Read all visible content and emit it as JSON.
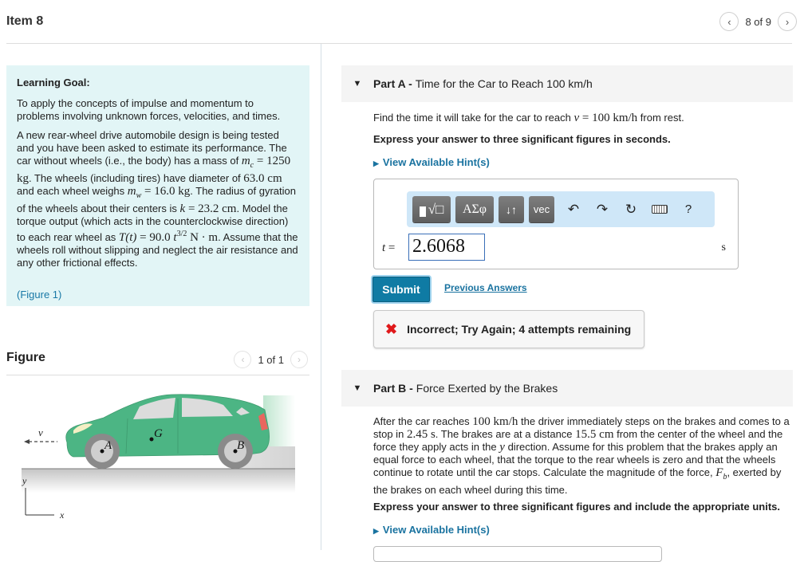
{
  "header": {
    "title": "Item 8",
    "pager_text": "8 of 9",
    "prev_icon": "chevron-left-icon",
    "next_icon": "chevron-right-icon"
  },
  "learning_goal": {
    "heading": "Learning Goal:",
    "intro": "To apply the concepts of impulse and momentum to problems involving unknown forces, velocities, and times.",
    "p1_a": "A new rear-wheel drive automobile design is being tested and you have been asked to estimate its performance. The car without wheels (i.e., the body) has a mass of",
    "mc_sym": "m",
    "mc_sub": "c",
    "mc_val": " = 1250 kg",
    "p1_b": ". The wheels (including tires) have diameter of",
    "diam": "63.0 cm",
    "p1_c": "and each wheel weighs",
    "mw_sym": "m",
    "mw_sub": "w",
    "mw_val": " = 16.0 kg",
    "p1_d": ". The radius of gyration of the wheels about their centers is",
    "k_sym": "k",
    "k_val": " = 23.2 cm",
    "p1_e": ". Model the torque output (which acts in the counterclockwise direction) to each rear wheel as",
    "torque_lhs": "T(t)",
    "torque_rhs": " = 90.0 ",
    "torque_t": "t",
    "torque_exp": "3/2",
    "torque_unit": " N · m",
    "p1_f": ". Assume that the wheels roll without slipping and neglect the air resistance and any other frictional effects.",
    "figure_link": "(Figure 1)"
  },
  "figure": {
    "title": "Figure",
    "pager_text": "1 of 1",
    "labels": {
      "v": "v",
      "G": "G",
      "A": "A",
      "B": "B",
      "x": "x",
      "y": "y"
    },
    "colors": {
      "car_body": "#4cb584",
      "wheel": "#8a8a8a",
      "hub": "#cfcfcf",
      "window": "#dcdcdc",
      "taillight": "#e9665f"
    }
  },
  "part_a": {
    "label": "Part A -",
    "title": "Time for the Car to Reach 100 km/h",
    "prompt_a": "Find the time it will take for the car to reach",
    "prompt_var": "v",
    "prompt_val": " = 100 km/h",
    "prompt_b": "from rest.",
    "instruction": "Express your answer to three significant figures in seconds.",
    "hint_link": "View Available Hint(s)",
    "toolbar": {
      "templates_label": "■√□",
      "greek_label": "ΑΣφ",
      "arrows_label": "↓↑",
      "vec_label": "vec",
      "help_label": "?"
    },
    "answer_var": "t",
    "answer_eq": " =",
    "answer_value": "2.6068",
    "unit": "s",
    "submit_label": "Submit",
    "previous_answers_label": "Previous Answers",
    "feedback": "Incorrect; Try Again; 4 attempts remaining"
  },
  "part_b": {
    "label": "Part B -",
    "title": "Force Exerted by the Brakes",
    "text_1": "After the car reaches",
    "speed": "100 km/h",
    "text_2": "the driver immediately steps on the brakes and comes to a stop in",
    "stop_time": "2.45 s",
    "text_3": ". The brakes are at a distance",
    "distance": "15.5 cm",
    "text_4": "from the center of the wheel and the force they apply acts in the",
    "dir_var": "y",
    "text_5": "direction. Assume for this problem that the brakes apply an equal force to each wheel, that the torque to the rear wheels is zero and that the wheels continue to rotate until the car stops. Calculate the magnitude of the force,",
    "fb_sym": "F",
    "fb_sub": "b",
    "text_6": ", exerted by the brakes on each wheel during this time.",
    "instruction": "Express your answer to three significant figures and include the appropriate units.",
    "hint_link": "View Available Hint(s)"
  }
}
